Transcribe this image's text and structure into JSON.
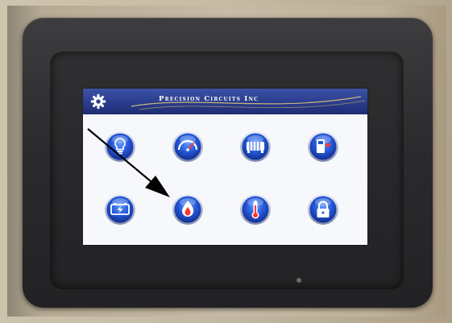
{
  "header": {
    "brand": "Precision Circuits Inc"
  },
  "colors": {
    "header_blue": "#2a3c8c",
    "button_blue": "#2456d6",
    "button_rim": "#1a2c78",
    "screen_bg": "#f7f8fb",
    "bezel": "#2b2b2d"
  },
  "tiles": [
    {
      "icon": "light-bulb-icon"
    },
    {
      "icon": "speedometer-gauge-icon"
    },
    {
      "icon": "heater-radiator-icon"
    },
    {
      "icon": "fuel-pump-icon"
    },
    {
      "icon": "battery-charging-icon"
    },
    {
      "icon": "flame-icon"
    },
    {
      "icon": "thermometer-icon"
    },
    {
      "icon": "padlock-icon"
    }
  ]
}
